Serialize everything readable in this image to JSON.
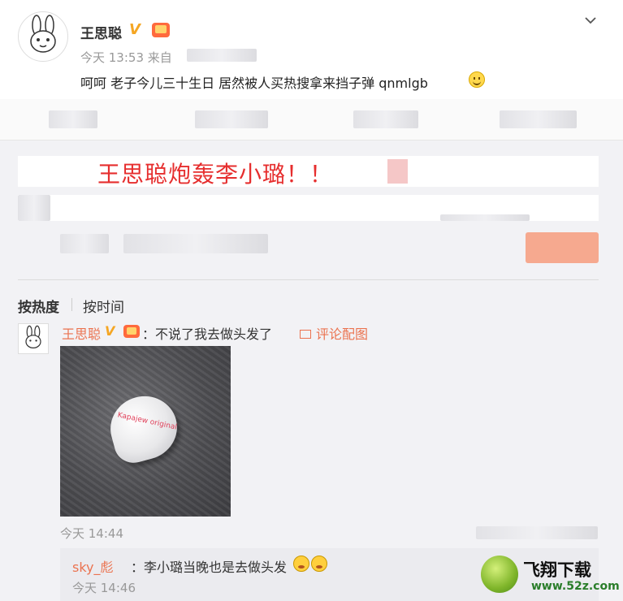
{
  "post": {
    "author": "王思聪",
    "verified_mark": "V",
    "time": "今天 13:53",
    "source_prefix": "来自",
    "text": "呵呵 老子今儿三十生日 居然被人买热搜拿来挡子弹 qnmlgb",
    "icons": [
      "chevron-down-icon",
      "smile-emoji-icon",
      "crown-badge-icon"
    ]
  },
  "headline": {
    "text": "王思聪炮轰李小璐！！",
    "color": "#e62e2e"
  },
  "sort_tabs": {
    "hot": "按热度",
    "time": "按时间"
  },
  "comment": {
    "author": "王思聪",
    "verified_mark": "V",
    "text": "：不说了我去做头发了",
    "reply_with_pic": "评论配图",
    "photo_label": "Kapajew original",
    "time": "今天 14:44"
  },
  "reply": {
    "author": "sky_彪",
    "text": "：李小璐当晚也是去做头发",
    "time": "今天 14:46"
  },
  "watermark": {
    "title": "飞翔下载",
    "url": "www.52z.com"
  },
  "colors": {
    "link_orange": "#eb7350",
    "verified_gold": "#f5a623",
    "headline_red": "#e62e2e"
  }
}
